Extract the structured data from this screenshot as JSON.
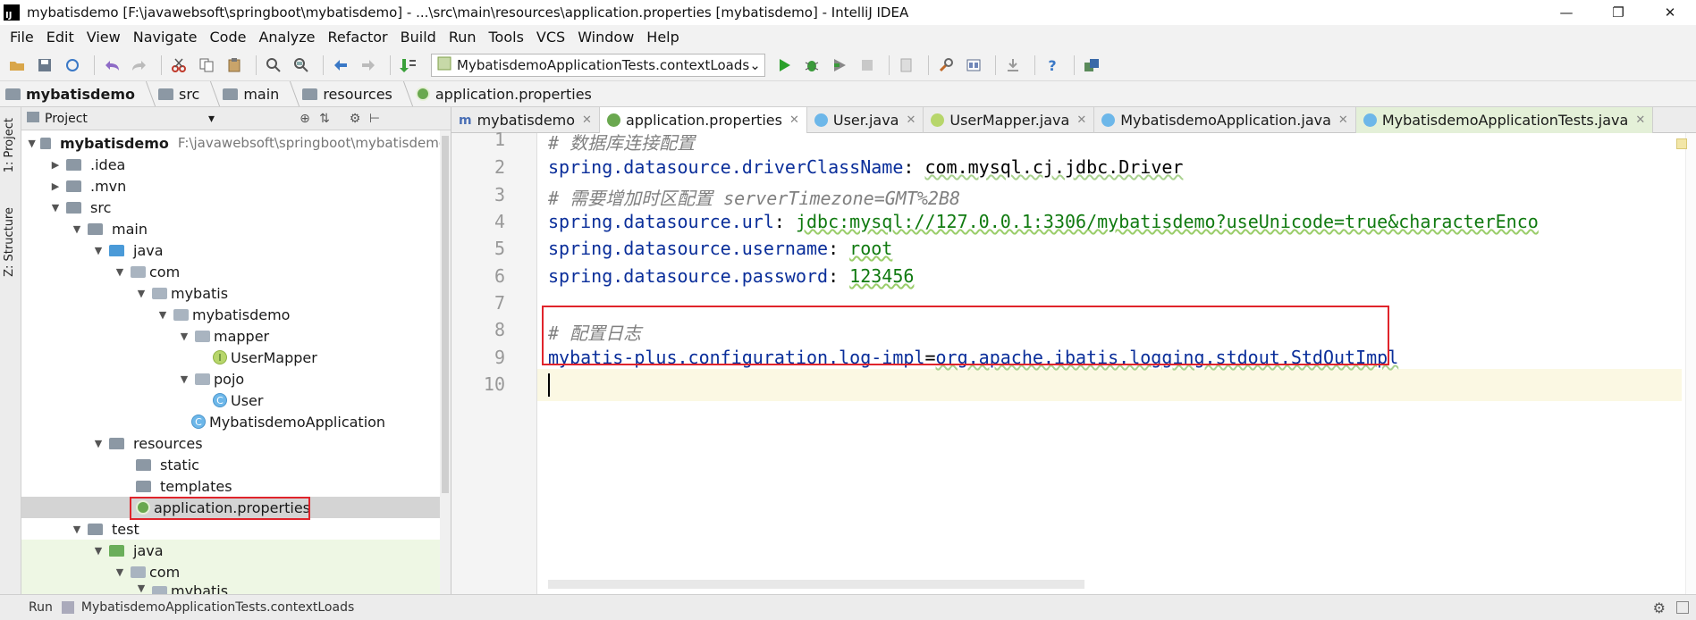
{
  "window": {
    "title": "mybatisdemo [F:\\javawebsoft\\springboot\\mybatisdemo] - ...\\src\\main\\resources\\application.properties [mybatisdemo] - IntelliJ IDEA",
    "logo_text": "IJ",
    "controls": [
      "—",
      "❐",
      "✕"
    ]
  },
  "menu": [
    "File",
    "Edit",
    "View",
    "Navigate",
    "Code",
    "Analyze",
    "Refactor",
    "Build",
    "Run",
    "Tools",
    "VCS",
    "Window",
    "Help"
  ],
  "toolbar": {
    "run_config": "MybatisdemoApplicationTests.contextLoads"
  },
  "breadcrumb": [
    "mybatisdemo",
    "src",
    "main",
    "resources",
    "application.properties"
  ],
  "left_strip": {
    "project_tab": "1: Project",
    "structure_tab": "Z: Structure"
  },
  "project_panel": {
    "title": "Project",
    "tree": [
      {
        "label": "mybatisdemo",
        "path": "F:\\javawebsoft\\springboot\\mybatisdemo"
      },
      {
        "label": ".idea"
      },
      {
        "label": ".mvn"
      },
      {
        "label": "src"
      },
      {
        "label": "main"
      },
      {
        "label": "java"
      },
      {
        "label": "com"
      },
      {
        "label": "mybatis"
      },
      {
        "label": "mybatisdemo"
      },
      {
        "label": "mapper"
      },
      {
        "label": "UserMapper"
      },
      {
        "label": "pojo"
      },
      {
        "label": "User"
      },
      {
        "label": "MybatisdemoApplication"
      },
      {
        "label": "resources"
      },
      {
        "label": "static"
      },
      {
        "label": "templates"
      },
      {
        "label": "application.properties"
      },
      {
        "label": "test"
      },
      {
        "label": "java"
      },
      {
        "label": "com"
      },
      {
        "label": "mybatis"
      }
    ]
  },
  "tabs": [
    {
      "label": "mybatisdemo"
    },
    {
      "label": "application.properties"
    },
    {
      "label": "User.java"
    },
    {
      "label": "UserMapper.java"
    },
    {
      "label": "MybatisdemoApplication.java"
    },
    {
      "label": "MybatisdemoApplicationTests.java"
    }
  ],
  "editor": {
    "line_numbers": [
      "1",
      "2",
      "3",
      "4",
      "5",
      "6",
      "7",
      "8",
      "9",
      "10"
    ],
    "lines": {
      "l1": "# 数据库连接配置",
      "l2_key": "spring.datasource.driverClassName",
      "l2_sep": ": ",
      "l2_val": "com.mysql.cj.jdbc.Driver",
      "l3": "# 需要增加时区配置 serverTimezone=GMT%2B8",
      "l4_key": "spring.datasource.url",
      "l4_sep": ": ",
      "l4_val": "jdbc:mysql://127.0.0.1:3306/mybatisdemo?useUnicode=true&characterEnco",
      "l5_key": "spring.datasource.username",
      "l5_sep": ": ",
      "l5_val": "root",
      "l6_key": "spring.datasource.password",
      "l6_sep": ": ",
      "l6_val": "123456",
      "l8": "# 配置日志",
      "l9_key": "mybatis-plus.configuration.log-impl",
      "l9_sep": "=",
      "l9_val": "org.apache.ibatis.logging.stdout.StdOutImpl"
    }
  },
  "statusbar": {
    "run_label": "Run",
    "run_target": "MybatisdemoApplicationTests.contextLoads"
  },
  "colors": {
    "highlight": "#e0242b",
    "comment": "#808080",
    "key": "#0a2e9a",
    "value": "#107a10"
  }
}
